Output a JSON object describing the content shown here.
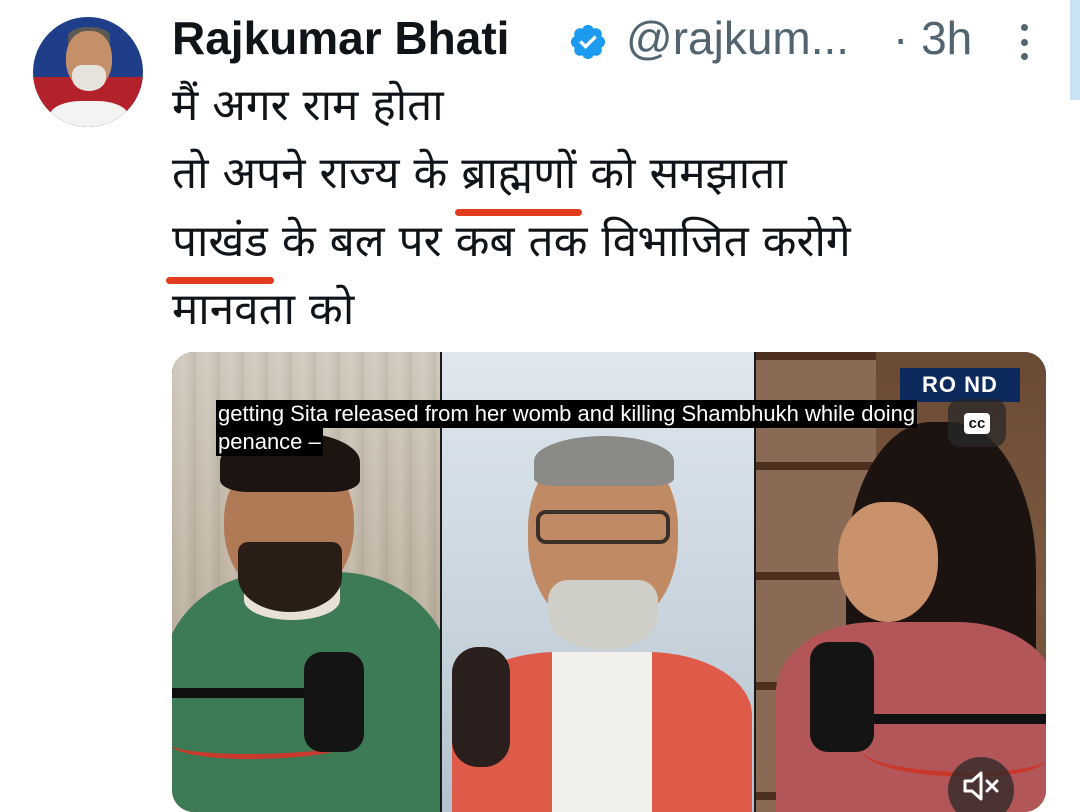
{
  "author": {
    "name": "Rajkumar Bhati",
    "handle": "@rajkum...",
    "time": "· 3h",
    "verified": true
  },
  "tweet": {
    "line1": "मैं अगर राम होता",
    "line2_a": "तो अपने राज्य के ",
    "line2_u": "ब्राह्मणों",
    "line2_b": " को समझाता",
    "line3_u": "पाखंड",
    "line3_b": " के बल पर कब तक विभाजित करोगे",
    "line4": "मानवता को"
  },
  "video": {
    "logo_text": "RO  ND",
    "caption_line1": "getting Sita released from her womb and killing Shambhukh while doing",
    "caption_line2": "penance –",
    "cc_label": "cc"
  },
  "colors": {
    "verified": "#1d9bf0",
    "underline": "#e23c1f",
    "muted_text": "#536471"
  },
  "icons": [
    "verified-badge-icon",
    "more-options-icon",
    "closed-captions-icon",
    "mute-icon"
  ]
}
